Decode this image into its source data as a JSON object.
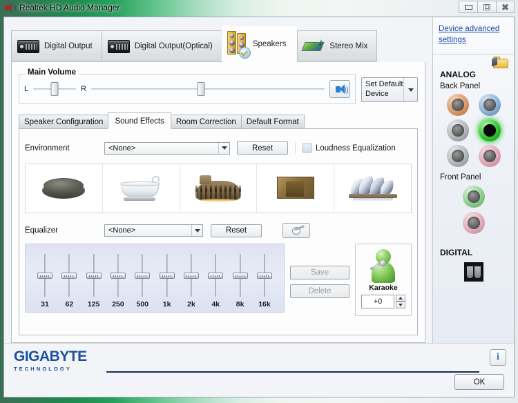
{
  "window": {
    "title": "Realtek HD Audio Manager",
    "icon": "speaker-icon",
    "minimize_label": "Minimize",
    "maximize_label": "Maximize",
    "close_label": "Close"
  },
  "device_tabs": [
    {
      "label": "Digital Output",
      "icon": "digital-output-icon",
      "active": false
    },
    {
      "label": "Digital Output(Optical)",
      "icon": "digital-output-optical-icon",
      "active": false
    },
    {
      "label": "Speakers",
      "icon": "speakers-icon",
      "active": true
    },
    {
      "label": "Stereo Mix",
      "icon": "stereo-mix-icon",
      "active": false
    }
  ],
  "main_volume": {
    "legend": "Main Volume",
    "left_label": "L",
    "right_label": "R",
    "balance_percent": 50,
    "volume_percent": 47,
    "mute_icon": "speaker-volume-icon",
    "muted": false
  },
  "set_default_device": {
    "label": "Set Default\nDevice",
    "label_line1": "Set Default",
    "label_line2": "Device",
    "dropdown_icon": "chevron-down-icon"
  },
  "inner_tabs": [
    {
      "label": "Speaker Configuration",
      "active": false
    },
    {
      "label": "Sound Effects",
      "active": true
    },
    {
      "label": "Room Correction",
      "active": false
    },
    {
      "label": "Default Format",
      "active": false
    }
  ],
  "sound_effects": {
    "environment": {
      "label": "Environment",
      "value": "<None>",
      "reset_label": "Reset"
    },
    "loudness": {
      "label": "Loudness Equalization",
      "checked": false
    },
    "environment_presets": [
      {
        "name": "stone-room-thumbnail"
      },
      {
        "name": "bathroom-thumbnail"
      },
      {
        "name": "arena-colosseum-thumbnail"
      },
      {
        "name": "wooden-room-thumbnail"
      },
      {
        "name": "concert-hall-opera-thumbnail"
      }
    ],
    "equalizer": {
      "label": "Equalizer",
      "value": "<None>",
      "reset_label": "Reset",
      "preset_icon": "guitar-icon",
      "bands": [
        {
          "freq": "31",
          "gain": 0
        },
        {
          "freq": "62",
          "gain": 0
        },
        {
          "freq": "125",
          "gain": 0
        },
        {
          "freq": "250",
          "gain": 0
        },
        {
          "freq": "500",
          "gain": 0
        },
        {
          "freq": "1k",
          "gain": 0
        },
        {
          "freq": "2k",
          "gain": 0
        },
        {
          "freq": "4k",
          "gain": 0
        },
        {
          "freq": "8k",
          "gain": 0
        },
        {
          "freq": "16k",
          "gain": 0
        }
      ],
      "save_label": "Save",
      "delete_label": "Delete",
      "save_enabled": false,
      "delete_enabled": false
    },
    "karaoke": {
      "label": "Karaoke",
      "icon": "karaoke-singer-icon",
      "value": "+0",
      "up_icon": "caret-up-icon",
      "down_icon": "caret-down-icon"
    }
  },
  "sidebar": {
    "advanced_link": "Device advanced settings",
    "folder_icon": "folder-icon",
    "analog_heading": "ANALOG",
    "back_panel_label": "Back Panel",
    "back_panel_jacks": [
      {
        "name": "jack-orange",
        "color": "#d99a6c",
        "active": false
      },
      {
        "name": "jack-blue",
        "color": "#8fb4d9",
        "active": false
      },
      {
        "name": "jack-gray-1",
        "color": "#b3b8bd",
        "active": false
      },
      {
        "name": "jack-green",
        "color": "#3cc83c",
        "active": true
      },
      {
        "name": "jack-gray-2",
        "color": "#b3b8bd",
        "active": false
      },
      {
        "name": "jack-pink",
        "color": "#e3a8b8",
        "active": false
      }
    ],
    "front_panel_label": "Front Panel",
    "front_panel_jacks": [
      {
        "name": "front-jack-green",
        "color": "#8ecf8e",
        "active": false
      },
      {
        "name": "front-jack-pink",
        "color": "#e0afbb",
        "active": false
      }
    ],
    "digital_heading": "DIGITAL",
    "digital_icon": "digital-jack-icon"
  },
  "footer": {
    "logo_main": "GIGABYTE",
    "logo_sub": "TECHNOLOGY",
    "info_label": "i",
    "ok_label": "OK"
  }
}
